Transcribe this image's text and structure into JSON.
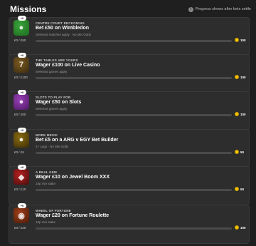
{
  "header": {
    "title": "Missions",
    "note": "Progress shows after bets settle"
  },
  "missions": [
    {
      "badge": "+0",
      "category": "CENTRE COURT RECKONING",
      "name": "Bet £50 on Wimbledon",
      "sub": "Selected matches apply · No Min Odds",
      "progress": "£0 / £50",
      "progress_fraction": 0,
      "reward": "100",
      "thumb_colors": [
        "#3aa33a",
        "#1e6b1e"
      ],
      "thumb_icon": "●"
    },
    {
      "badge": "+0",
      "category": "THE TABLES ARE YOURS",
      "name": "Wager £100 on Live Casino",
      "sub": "Selected games apply",
      "progress": "£0 / £100",
      "progress_fraction": 0,
      "reward": "100",
      "thumb_colors": [
        "#7a5a20",
        "#3b2a10"
      ],
      "thumb_icon": "7"
    },
    {
      "badge": "+0",
      "category": "SLOTS TO PLAY FOR",
      "name": "Wager £50 on Slots",
      "sub": "Selected games apply",
      "progress": "£0 / £50",
      "progress_fraction": 0,
      "reward": "100",
      "thumb_colors": [
        "#9b3fb8",
        "#4a1a60"
      ],
      "thumb_icon": "●"
    },
    {
      "badge": "+0",
      "category": "MORE MESSI",
      "name": "Bet £5 on a ARG v EGY Bet Builder",
      "sub": "2+ Legs · No Min Odds",
      "progress": "£0 / £5",
      "progress_fraction": 0,
      "reward": "50",
      "thumb_colors": [
        "#8a6a10",
        "#3b2e08"
      ],
      "thumb_icon": "●"
    },
    {
      "badge": "+0",
      "category": "A REAL GEM",
      "name": "Wager £10 on Jewel Boom XXX",
      "sub": "10p min stake",
      "progress": "£0 / £10",
      "progress_fraction": 0,
      "reward": "50",
      "thumb_colors": [
        "#b32020",
        "#4a0d0d"
      ],
      "thumb_icon": "◆"
    },
    {
      "badge": "+0",
      "category": "WHEEL OF FORTUNE",
      "name": "Wager £20 on Fortune Roulette",
      "sub": "10p min stake",
      "progress": "£0 / £20",
      "progress_fraction": 0,
      "reward": "100",
      "thumb_colors": [
        "#a0401a",
        "#4a1a08"
      ],
      "thumb_icon": "◉"
    }
  ]
}
